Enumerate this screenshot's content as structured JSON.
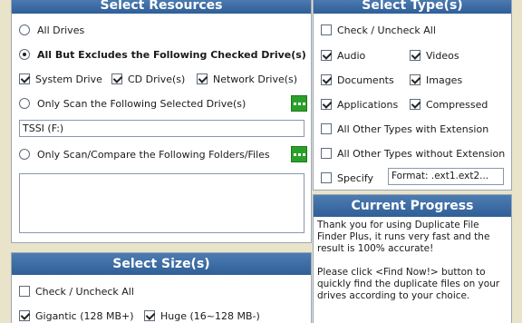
{
  "resources": {
    "title": "Select Resources",
    "all_drives": "All Drives",
    "all_but": "All But Excludes the Following Checked Drive(s)",
    "system_drive": "System Drive",
    "cd_drive": "CD Drive(s)",
    "network_drive": "Network Drive(s)",
    "only_scan_drives": "Only Scan the Following Selected Drive(s)",
    "drive_value": "TSSI (F:)",
    "only_scan_folders": "Only Scan/Compare the Following Folders/Files"
  },
  "size": {
    "title": "Select Size(s)",
    "check_all": "Check / Uncheck All",
    "gigantic": "Gigantic (128 MB+)",
    "huge": "Huge (16~128 MB-)"
  },
  "types": {
    "title": "Select Type(s)",
    "check_all": "Check / Uncheck All",
    "audio": "Audio",
    "videos": "Videos",
    "documents": "Documents",
    "images": "Images",
    "applications": "Applications",
    "compressed": "Compressed",
    "other_with_ext": "All Other Types with Extension",
    "other_without_ext": "All Other Types without Extension",
    "specify": "Specify",
    "specify_value": "Format: .ext1.ext2..."
  },
  "progress": {
    "title": "Current Progress",
    "line1": "Thank you for using Duplicate File",
    "line2": "Finder Plus, it runs very fast and the",
    "line3": "result is 100% accurate!",
    "line4": "Please click <Find Now!> button to",
    "line5": "quickly find the duplicate files on your",
    "line6": "drives according to your choice."
  },
  "colors": {
    "header": "#2f5f97",
    "accent_button": "#2aa02a",
    "background": "#e9e3c9"
  },
  "icons": {
    "browse_drives": "dots-icon",
    "browse_folders": "dots-icon"
  }
}
